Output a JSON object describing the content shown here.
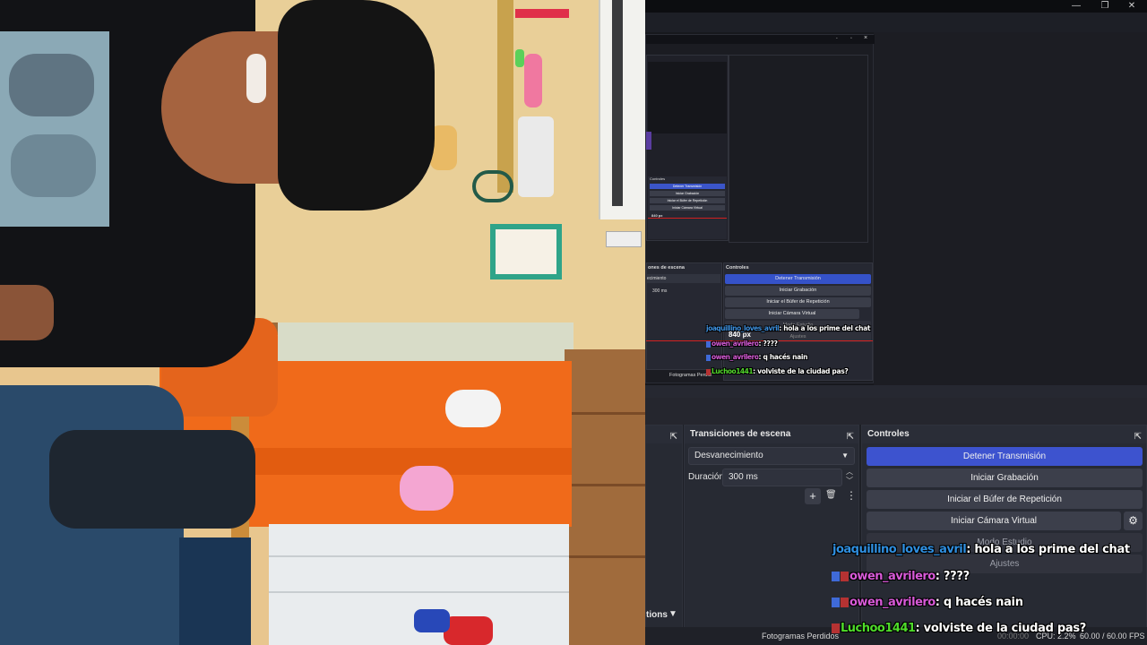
{
  "window": {
    "min_glyph": "—",
    "restore_glyph": "❐",
    "close_glyph": "✕"
  },
  "nested": {
    "min": "-",
    "restore": "▫",
    "close": "×",
    "scene_transitions_title": "ones de escena",
    "controls_title": "Controles",
    "transition_value": "ecimiento",
    "duration_value": "300 ms",
    "buttons": [
      "Detener Transmisión",
      "Iniciar Grabación",
      "Iniciar el Búfer de Repetición",
      "Iniciar Cámara Virtual",
      "Modo Estudio",
      "Ajustes"
    ],
    "width_label": "840 px",
    "status_text": "Fotogramas Perdid",
    "tiny_lines": [
      "Controles",
      "Detener Transmisión",
      "Iniciar Grabación",
      "Iniciar el Búfer de Repetición",
      "Iniciar Cámara Virtual"
    ],
    "tiny_width_label": "840 px",
    "chat": [
      {
        "user": "joaquillino_loves_avril",
        "msg": ": hola a los prime del chat",
        "color": "#3d8fdc"
      },
      {
        "user": "owen_avrilero",
        "msg": ": ????",
        "color": "#d45ad4"
      },
      {
        "user": "owen_avrilero",
        "msg": ": q hacés nain",
        "color": "#d45ad4"
      },
      {
        "user": "Luchoo1441",
        "msg": ": volviste de la ciudad pas?",
        "color": "#52d62c"
      }
    ]
  },
  "transitions_dock": {
    "title": "Transiciones de escena",
    "transition_value": "Desvanecimiento",
    "duration_label": "Duración",
    "duration_value": "300 ms",
    "add_icon": "+",
    "delete_icon": "🗑",
    "more_icon": "⋮"
  },
  "controls_dock": {
    "title": "Controles",
    "buttons": {
      "stop_stream": "Detener Transmisión",
      "start_recording": "Iniciar Grabación",
      "replay_buffer": "Iniciar el Búfer de Repetición",
      "virtual_camera": "Iniciar Cámara Virtual",
      "studio_mode": "Modo Estudio",
      "settings": "Ajustes"
    }
  },
  "left_dock": {
    "fragment_label": "tions"
  },
  "statusbar": {
    "dropped_frames": "Fotogramas Perdidos",
    "time": "00:00:00",
    "cpu": "CPU: 2.2%",
    "fps": "60.00 / 60.00 FPS"
  },
  "chat": [
    {
      "user": "joaquillino_loves_avril",
      "msg": ": hola a los prime del chat",
      "color": "#2f8fe0",
      "badges": 0
    },
    {
      "user": "owen_avrilero",
      "msg": ": ????",
      "color": "#d85ad8",
      "badges": 2
    },
    {
      "user": "owen_avrilero",
      "msg": ": q hacés nain",
      "color": "#d85ad8",
      "badges": 2
    },
    {
      "user": "Luchoo1441",
      "msg": ": volviste de la ciudad pas?",
      "color": "#4fdc2a",
      "badges": 1
    }
  ]
}
